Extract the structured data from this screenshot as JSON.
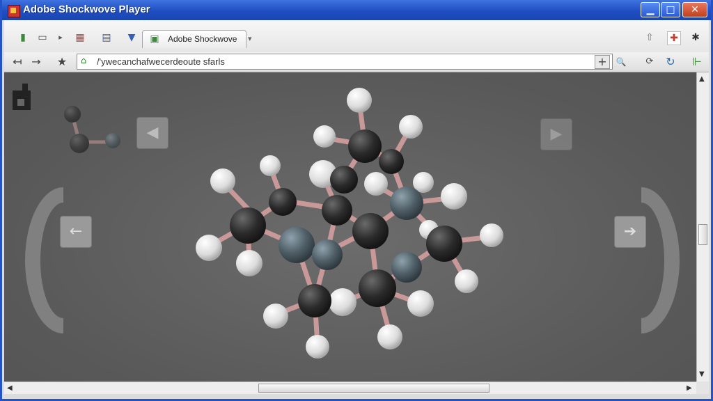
{
  "window": {
    "title": "Adobe Shockwove Player",
    "controls": {
      "minimize": "▁",
      "maximize": "□",
      "close": "✕"
    }
  },
  "tab": {
    "label": "Adobe Shockwove",
    "close_glyph": "▾"
  },
  "address_bar": {
    "url": "/'ywecanchafwecerdeoute sfarls"
  },
  "icons": {
    "nav_back": "↤",
    "nav_forward": "→",
    "bookmark": "★",
    "add": "+",
    "settings": "✱",
    "prev_slide": "◀",
    "next_slide": "▶",
    "rotate_left": "←",
    "rotate_right": "➔"
  },
  "colors": {
    "title_bar": "#1f4ec2",
    "canvas_bg": "#5f5f5f",
    "carbon_atom": "#2b2b2b",
    "nitrogen_atom": "#4f5e66",
    "hydrogen_atom": "#e6e6e6",
    "bond": "#c99898"
  }
}
